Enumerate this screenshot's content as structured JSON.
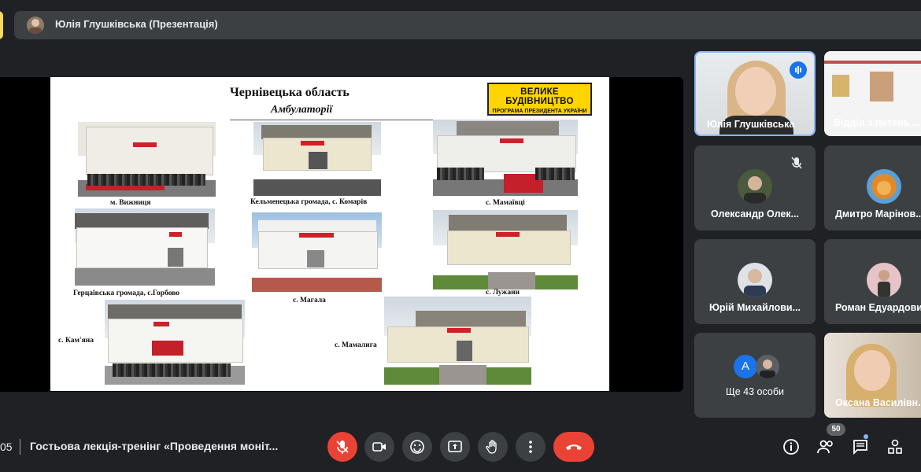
{
  "presenter_bar": {
    "title": "Юлія Глушківська (Презентація)"
  },
  "slide": {
    "title": "Чернівецька область",
    "subtitle": "Амбулаторії",
    "logo_top": "ВЕЛИКЕ БУДІВНИЦТВО",
    "logo_bottom": "ПРОГРАМА ПРЕЗИДЕНТА УКРАЇНИ",
    "captions": [
      "м. Вижниця",
      "Кельменецька громада, с. Комарів",
      "с. Мамаївці",
      "Герцаївська громада, с.Горбово",
      "с. Магала",
      "с. Лужани",
      "с. Кам'яна",
      "с. Мамалига"
    ]
  },
  "participants": [
    {
      "name": "Юлія Глушківська",
      "speaking": true
    },
    {
      "name": "Відділ з питань ..."
    },
    {
      "name": "Олександр Олек...",
      "muted": true
    },
    {
      "name": "Дмитро Марінов..."
    },
    {
      "name": "Юрій Михайлови..."
    },
    {
      "name": "Роман Едуардови..."
    },
    {
      "name": "Ще 43 особи",
      "avatar_letter": "A"
    },
    {
      "name": "Оксана Василівн..."
    }
  ],
  "bottom_bar": {
    "time": "05",
    "meeting_name": "Гостьова лекція-тренінг «Проведення моніт...",
    "people_count": "50"
  },
  "colors": {
    "end_call": "#ea4335",
    "mic_off": "#ea4335",
    "logo_bg": "#ffd500",
    "speaking": "#8ab4f8"
  }
}
